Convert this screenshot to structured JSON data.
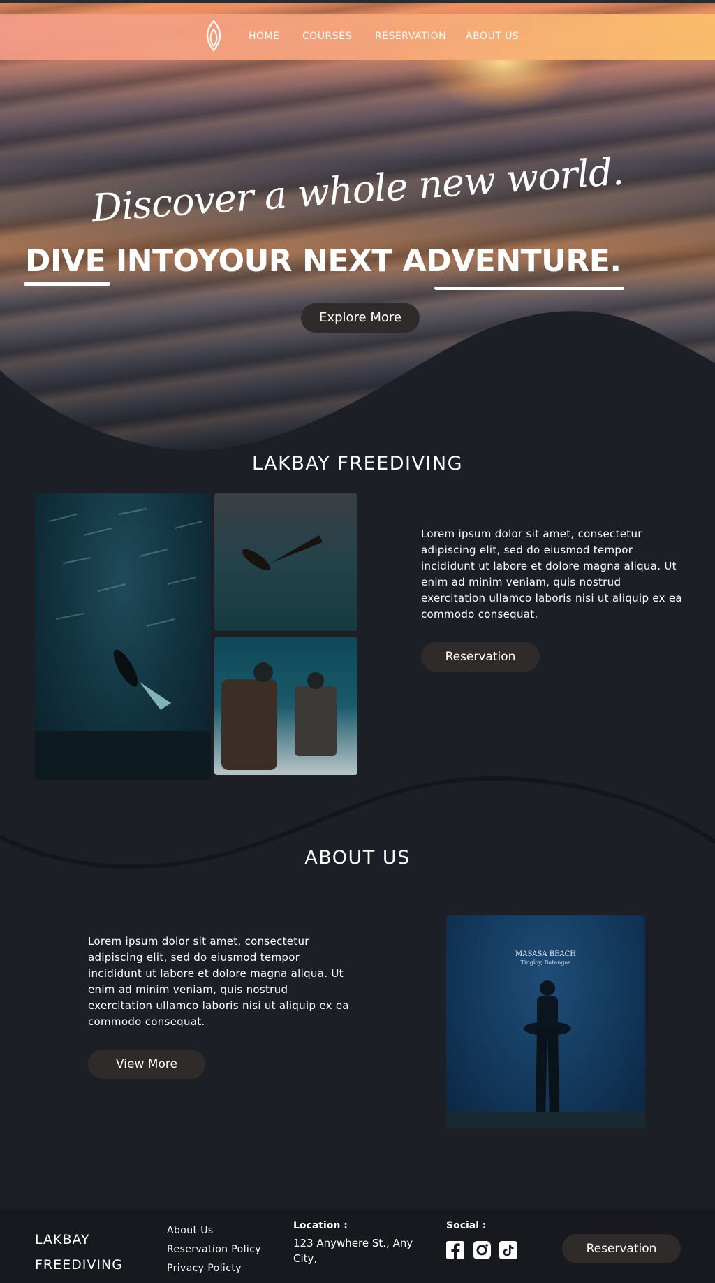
{
  "nav": {
    "logo": "lotus-drop-logo",
    "items": [
      {
        "label": "HOME"
      },
      {
        "label": "COURSES"
      },
      {
        "label": "RESERVATION"
      },
      {
        "label": "ABOUT US"
      }
    ]
  },
  "hero": {
    "script_title": "Discover a whole new world.",
    "main_title": "DIVE INTOYOUR NEXT ADVENTURE.",
    "cta_label": "Explore More"
  },
  "lakbay": {
    "title": "LAKBAY FREEDIVING",
    "paragraph": "Lorem ipsum dolor sit amet, consectetur adipiscing elit, sed do eiusmod tempor incididunt ut labore et dolore magna aliqua. Ut enim ad minim veniam, quis nostrud exercitation ullamco laboris nisi ut aliquip ex ea commodo consequat.",
    "button_label": "Reservation"
  },
  "about": {
    "title": "ABOUT US",
    "paragraph": "Lorem ipsum dolor sit amet, consectetur adipiscing elit, sed do eiusmod tempor incididunt ut labore et dolore magna aliqua. Ut enim ad minim veniam, quis nostrud exercitation ullamco laboris nisi ut aliquip ex ea commodo consequat.",
    "button_label": "View More",
    "photo_caption_title": "MASASA BEACH",
    "photo_caption_sub": "Tingloy, Batangas"
  },
  "footer": {
    "brand_line1": "LAKBAY",
    "brand_line2": "FREEDIVING",
    "links": [
      "About Us",
      "Reservation Policy",
      "Privacy Policty"
    ],
    "location_title": "Location :",
    "location_text": "123 Anywhere St., Any City,",
    "social_title": "Social :",
    "social_icons": [
      "facebook-icon",
      "instagram-icon",
      "tiktok-icon"
    ],
    "button_label": "Reservation"
  },
  "colors": {
    "background": "#1d1f27",
    "button": "#2f2b2b",
    "nav_gradient_start": "#f29a86",
    "nav_gradient_end": "#fbbf6b",
    "footer": "#17191f"
  }
}
